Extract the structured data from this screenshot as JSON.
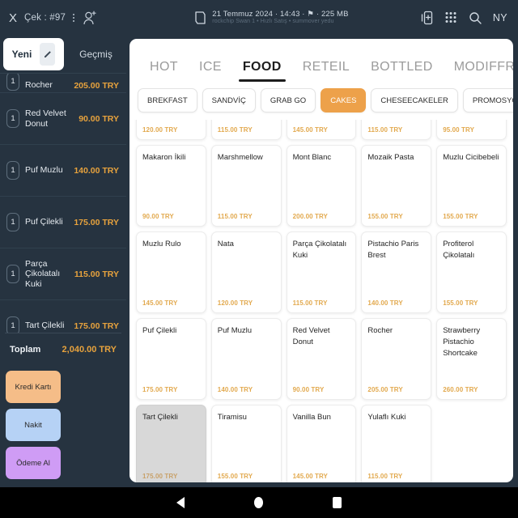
{
  "topbar": {
    "close_label": "X",
    "check_label": "Çek : #97",
    "overflow_icon": "kebab-menu-icon",
    "add_user_icon": "add-person-icon",
    "printer_icon": "printer-icon",
    "title": "21 Temmuz 2024 · 14:43 · ⚑ · 225 MB",
    "subtitle": "rockchip Swan 1 • Hızlı Satış • summover yedu",
    "add_list_icon": "add-to-list-icon",
    "qr_icon": "qr-grid-icon",
    "search_icon": "search-icon",
    "user_initials": "NY"
  },
  "sidebar": {
    "tabs": [
      {
        "label": "Yeni",
        "active": true,
        "edit_icon": "pencil-icon"
      },
      {
        "label": "Geçmiş",
        "active": false
      }
    ],
    "items": [
      {
        "qty": "1",
        "name": "Rocher",
        "price": "205.00 TRY",
        "clipped": true
      },
      {
        "qty": "1",
        "name": "Red Velvet Donut",
        "price": "90.00 TRY"
      },
      {
        "qty": "1",
        "name": "Puf Muzlu",
        "price": "140.00 TRY"
      },
      {
        "qty": "1",
        "name": "Puf Çilekli",
        "price": "175.00 TRY"
      },
      {
        "qty": "1",
        "name": "Parça Çikolatalı Kuki",
        "price": "115.00 TRY"
      },
      {
        "qty": "1",
        "name": "Tart Çilekli",
        "price": "175.00 TRY"
      }
    ],
    "total_label": "Toplam",
    "total_value": "2,040.00 TRY",
    "pay_buttons": [
      {
        "label": "Kredi Kartı",
        "color": "#f5bd88"
      },
      {
        "label": "Nakit",
        "color": "#b6d2f5"
      },
      {
        "label": "Ödeme Al",
        "color": "#cf9cf5"
      }
    ]
  },
  "main": {
    "categories": [
      {
        "label": "HOT",
        "active": false
      },
      {
        "label": "ICE",
        "active": false
      },
      {
        "label": "FOOD",
        "active": true
      },
      {
        "label": "RETEIL",
        "active": false
      },
      {
        "label": "BOTTLED",
        "active": false
      },
      {
        "label": "MODIFFRES",
        "active": false
      }
    ],
    "subcategories": [
      {
        "label": "BREKFAST",
        "active": false
      },
      {
        "label": "SANDVİÇ",
        "active": false
      },
      {
        "label": "GRAB GO",
        "active": false
      },
      {
        "label": "CAKES",
        "active": true
      },
      {
        "label": "CHESEECAKELER",
        "active": false
      },
      {
        "label": "PROMOSYON",
        "active": false
      }
    ],
    "products": [
      {
        "name": "",
        "price": "120.00 TRY",
        "pressed": false
      },
      {
        "name": "",
        "price": "115.00 TRY",
        "pressed": false
      },
      {
        "name": "",
        "price": "145.00 TRY",
        "pressed": false
      },
      {
        "name": "",
        "price": "115.00 TRY",
        "pressed": false
      },
      {
        "name": "",
        "price": "95.00 TRY",
        "pressed": false
      },
      {
        "name": "Makaron İkili",
        "price": "90.00 TRY",
        "pressed": false
      },
      {
        "name": "Marshmellow",
        "price": "115.00 TRY",
        "pressed": false
      },
      {
        "name": "Mont Blanc",
        "price": "200.00 TRY",
        "pressed": false
      },
      {
        "name": "Mozaik Pasta",
        "price": "155.00 TRY",
        "pressed": false
      },
      {
        "name": "Muzlu Cicibebeli",
        "price": "155.00 TRY",
        "pressed": false
      },
      {
        "name": "Muzlu Rulo",
        "price": "145.00 TRY",
        "pressed": false
      },
      {
        "name": "Nata",
        "price": "120.00 TRY",
        "pressed": false
      },
      {
        "name": "Parça Çikolatalı Kuki",
        "price": "115.00 TRY",
        "pressed": false
      },
      {
        "name": "Pistachio Paris Brest",
        "price": "140.00 TRY",
        "pressed": false
      },
      {
        "name": "Profiterol Çikolatalı",
        "price": "155.00 TRY",
        "pressed": false
      },
      {
        "name": "Puf Çilekli",
        "price": "175.00 TRY",
        "pressed": false
      },
      {
        "name": "Puf Muzlu",
        "price": "140.00 TRY",
        "pressed": false
      },
      {
        "name": "Red Velvet Donut",
        "price": "90.00 TRY",
        "pressed": false
      },
      {
        "name": "Rocher",
        "price": "205.00 TRY",
        "pressed": false
      },
      {
        "name": "Strawberry Pistachio Shortcake",
        "price": "260.00 TRY",
        "pressed": false
      },
      {
        "name": "Tart Çilekli",
        "price": "175.00 TRY",
        "pressed": true
      },
      {
        "name": "Tiramisu",
        "price": "155.00 TRY",
        "pressed": false
      },
      {
        "name": "Vanilla Bun",
        "price": "145.00 TRY",
        "pressed": false
      },
      {
        "name": "Yulaflı Kuki",
        "price": "115.00 TRY",
        "pressed": false
      }
    ]
  },
  "navbar": {
    "back_icon": "back-triangle-icon",
    "home_icon": "home-circle-icon",
    "recents_icon": "recents-square-icon"
  },
  "colors": {
    "dark_bg": "#263340",
    "accent_orange": "#eda14a",
    "price_gold": "#e8a33d"
  }
}
